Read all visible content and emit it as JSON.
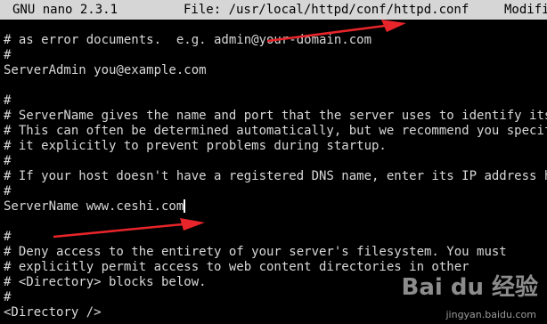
{
  "titlebar": {
    "app": "GNU nano 2.3.1",
    "file": "File: /usr/local/httpd/conf/httpd.conf",
    "status": "Modifi"
  },
  "editor": {
    "lines": [
      "# as error documents.  e.g. admin@your-domain.com",
      "#",
      "ServerAdmin you@example.com",
      "",
      "#",
      "# ServerName gives the name and port that the server uses to identify itself",
      "# This can often be determined automatically, but we recommend you specify",
      "# it explicitly to prevent problems during startup.",
      "#",
      "# If your host doesn't have a registered DNS name, enter its IP address here.",
      "#",
      "ServerName www.ceshi.com",
      "",
      "#",
      "# Deny access to the entirety of your server's filesystem. You must",
      "# explicitly permit access to web content directories in other",
      "# <Directory> blocks below.",
      "#",
      "<Directory />"
    ]
  },
  "annotation": {
    "arrow_color": "#e8252a"
  },
  "watermark": {
    "logo": "Bai du 经验",
    "url": "jingyan.baidu.com"
  },
  "colors": {
    "background": "#000000",
    "text": "#d8d8d8",
    "titlebar_bg": "#d6d6d6",
    "titlebar_text": "#000000"
  }
}
